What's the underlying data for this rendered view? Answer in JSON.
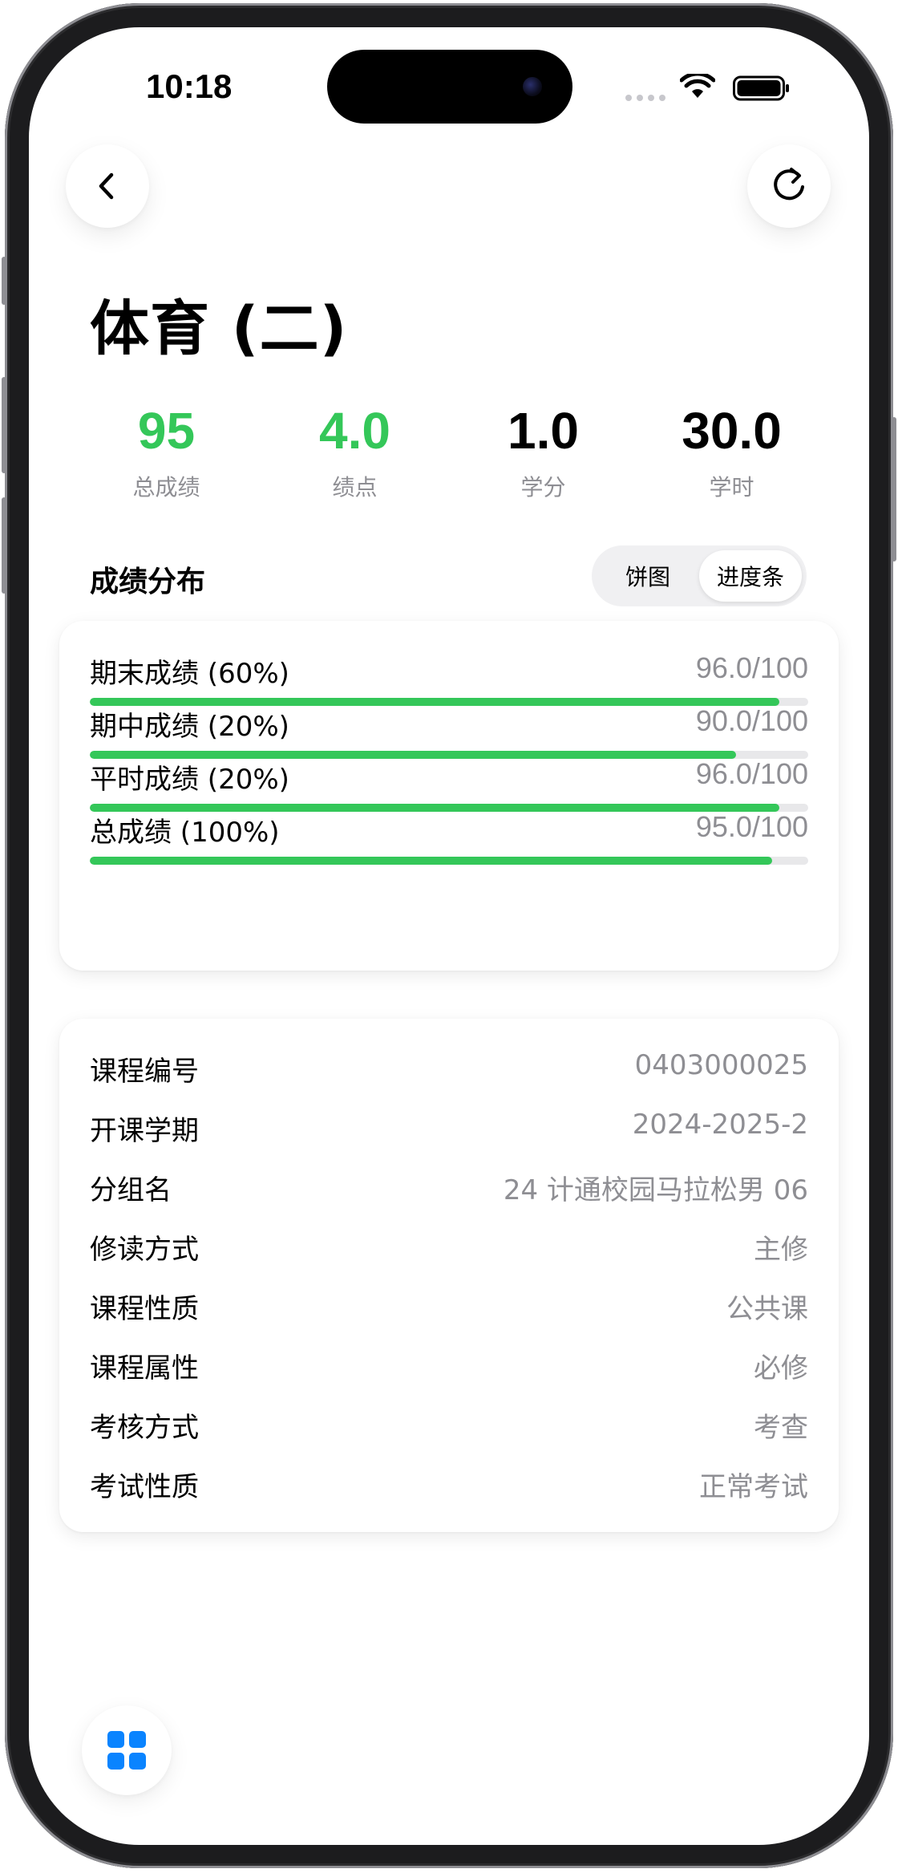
{
  "status_bar": {
    "time": "10:18"
  },
  "nav": {
    "back_icon": "chevron-left-icon",
    "refresh_icon": "refresh-icon"
  },
  "course": {
    "title": "体育 (二)"
  },
  "stats": [
    {
      "value": "95",
      "label": "总成绩",
      "color": "#34c759"
    },
    {
      "value": "4.0",
      "label": "绩点",
      "color": "#34c759"
    },
    {
      "value": "1.0",
      "label": "学分",
      "color": "#000000"
    },
    {
      "value": "30.0",
      "label": "学时",
      "color": "#000000"
    }
  ],
  "distribution": {
    "title": "成绩分布",
    "toggle": {
      "options": [
        "饼图",
        "进度条"
      ],
      "selected": "进度条"
    },
    "items": [
      {
        "label": "期末成绩 (60%)",
        "score": "96.0/100",
        "value": 96
      },
      {
        "label": "期中成绩 (20%)",
        "score": "90.0/100",
        "value": 90
      },
      {
        "label": "平时成绩 (20%)",
        "score": "96.0/100",
        "value": 96
      },
      {
        "label": "总成绩 (100%)",
        "score": "95.0/100",
        "value": 95
      }
    ]
  },
  "info": [
    {
      "key": "课程编号",
      "value": "0403000025"
    },
    {
      "key": "开课学期",
      "value": "2024-2025-2"
    },
    {
      "key": "分组名",
      "value": "24 计通校园马拉松男 06"
    },
    {
      "key": "修读方式",
      "value": "主修"
    },
    {
      "key": "课程性质",
      "value": "公共课"
    },
    {
      "key": "课程属性",
      "value": "必修"
    },
    {
      "key": "考核方式",
      "value": "考查"
    },
    {
      "key": "考试性质",
      "value": "正常考试"
    }
  ],
  "colors": {
    "accent_green": "#34c759",
    "accent_blue": "#0a84ff",
    "muted_text": "#8e8e93"
  }
}
